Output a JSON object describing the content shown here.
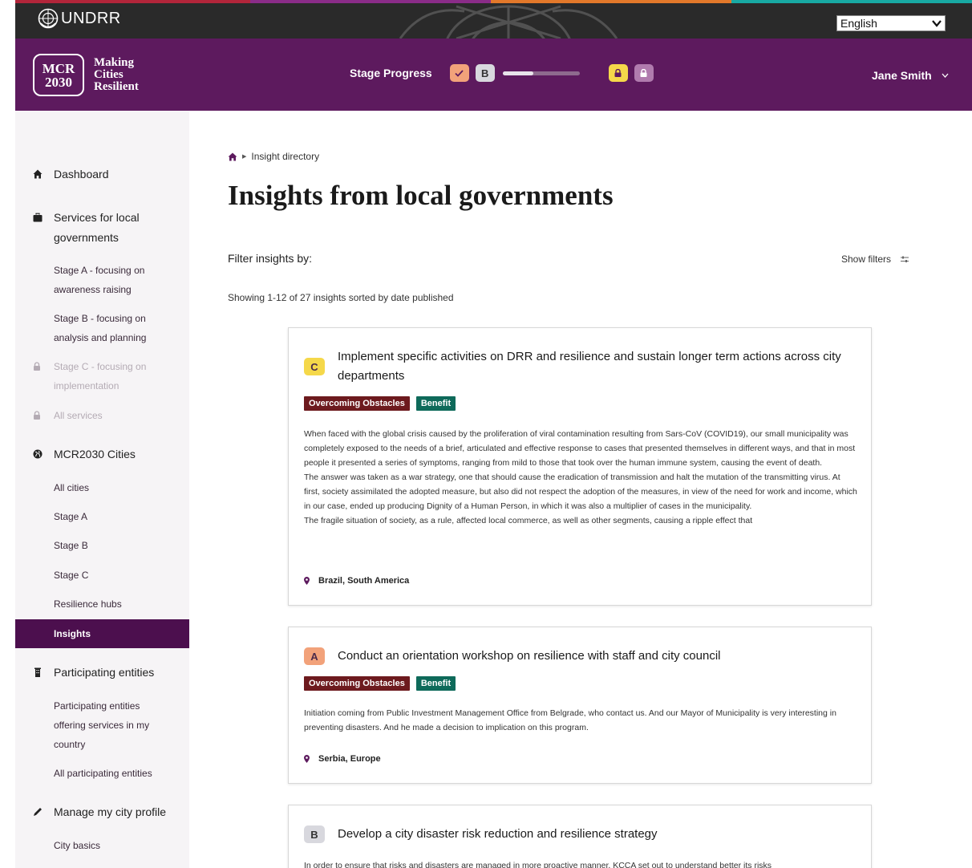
{
  "colors": {
    "header_purple": "#5d1a5e",
    "active_nav": "#4c0f4e",
    "stage_a": "#f2a27a",
    "stage_b": "#d8d8de",
    "stage_c": "#f5d84a",
    "stage_d": "#b07bae",
    "tag_obstacle": "#6d1a1e",
    "tag_benefit": "#0e6a5a",
    "stripe_colors": [
      "#b2253a",
      "#8a2c88",
      "#e2782a",
      "#18a9a3"
    ]
  },
  "topbar": {
    "org_name": "UNDRR",
    "language": "English",
    "icons": [
      "un-emblem-icon",
      "chevron-down-icon"
    ]
  },
  "header": {
    "logo_line1": "MCR",
    "logo_line2": "2030",
    "tagline1": "Making",
    "tagline2": "Cities",
    "tagline3": "Resilient",
    "stage_progress_label": "Stage Progress",
    "stage_b_letter": "B",
    "stage_progress_fraction": 0.4,
    "icons": [
      "check-icon",
      "lock-icon",
      "lock-icon"
    ],
    "user_name": "Jane Smith"
  },
  "sidebar": {
    "dashboard": "Dashboard",
    "services": "Services for local governments",
    "stage_a": "Stage A - focusing on awareness raising",
    "stage_b": "Stage B - focusing on analysis and planning",
    "stage_c": "Stage C - focusing on implementation",
    "all_services": "All services",
    "cities": "MCR2030 Cities",
    "all_cities": "All cities",
    "cities_stage_a": "Stage A",
    "cities_stage_b": "Stage B",
    "cities_stage_c": "Stage C",
    "resilience_hubs": "Resilience hubs",
    "insights": "Insights",
    "participating": "Participating entities",
    "participating_country": "Participating entities offering services in my country",
    "all_participating": "All participating entities",
    "manage_profile": "Manage my city profile",
    "city_basics": "City basics",
    "icons": [
      "home-icon",
      "briefcase-icon",
      "lock-icon",
      "globe-icon",
      "building-icon",
      "pencil-icon"
    ]
  },
  "main": {
    "breadcrumb": "Insight directory",
    "title": "Insights from local governments",
    "filter_label": "Filter insights by:",
    "show_filters": "Show filters",
    "result_count": "Showing 1-12 of 27 insights sorted by date published"
  },
  "cards": [
    {
      "stage": "C",
      "title": "Implement specific activities on DRR and resilience and sustain longer term actions across city departments",
      "tags": [
        "Overcoming Obstacles",
        "Benefit"
      ],
      "body": [
        "When faced with the global crisis caused by the proliferation of viral contamination resulting from Sars-CoV (COVID19), our small municipality was completely exposed to the needs of a brief, articulated and effective response to cases that presented themselves in different ways, and that in most people it presented a series of symptoms, ranging from mild to those that took over the human immune system, causing the event of death.",
        "The answer was taken as a war strategy, one that should cause the eradication of transmission and halt the mutation of the transmitting virus. At first, society assimilated the adopted measure, but also did not respect the adoption of the measures, in view of the need for work and income, which in our case, ended up producing Dignity of a Human Person, in which it was also a multiplier of cases in the municipality.",
        "The fragile situation of society, as a rule, affected local commerce, as well as other segments, causing a ripple effect that"
      ],
      "location": "Brazil, South America"
    },
    {
      "stage": "A",
      "title": "Conduct an orientation workshop on resilience with staff and city council",
      "tags": [
        "Overcoming Obstacles",
        "Benefit"
      ],
      "body": [
        "Initiation coming from Public Investment  Management Office from Belgrade, who contact us. And our Mayor of Municipality is very interesting in preventing disasters. And he made a decision to implication on this program."
      ],
      "location": "Serbia, Europe"
    },
    {
      "stage": "B",
      "title": "Develop a city disaster risk reduction and resilience strategy",
      "body": [
        "In order to ensure that risks and disasters are managed in more proactive manner, KCCA set out to understand better its risks"
      ]
    }
  ]
}
